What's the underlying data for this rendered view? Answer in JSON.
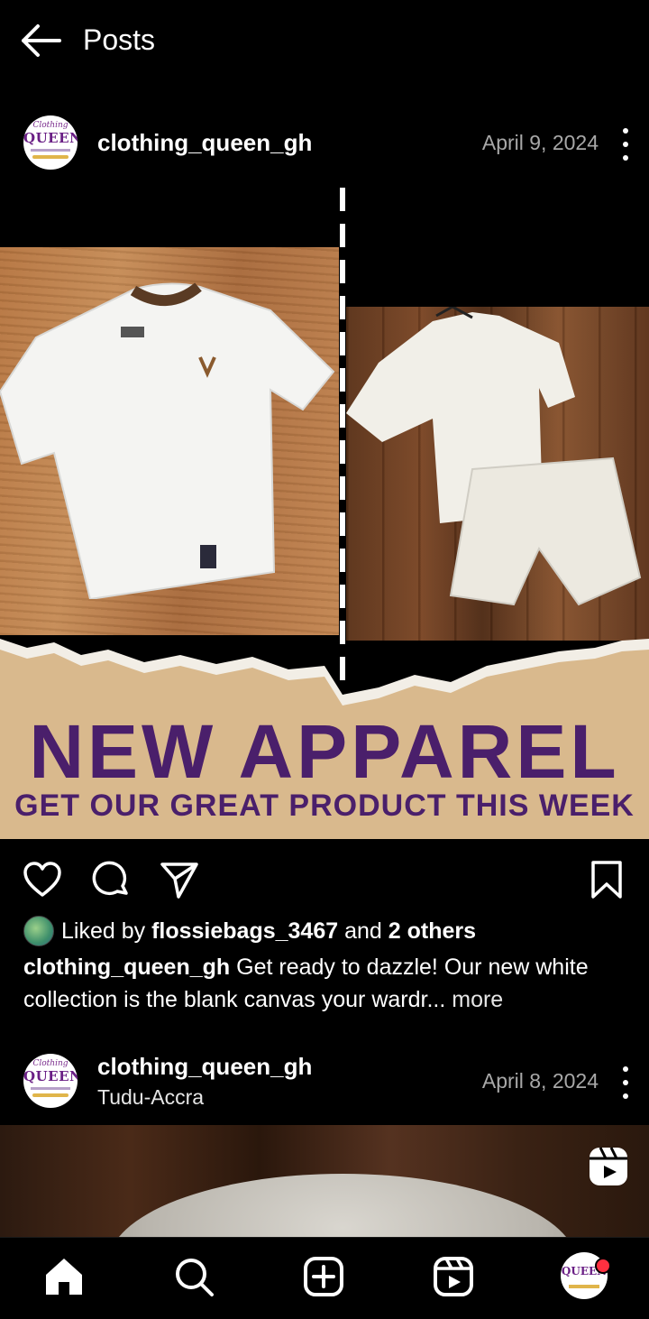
{
  "header": {
    "title": "Posts",
    "back_icon": "arrow-left-icon"
  },
  "posts": [
    {
      "username": "clothing_queen_gh",
      "location": "",
      "date": "April 9, 2024",
      "avatar_logo_top": "Clothing",
      "avatar_logo_main": "QUEEN",
      "image": {
        "banner_title": "NEW APPAREL",
        "banner_subtitle": "GET OUR GREAT PRODUCT THIS WEEK"
      },
      "likes": {
        "prefix": "Liked by",
        "user": "flossiebags_3467",
        "and": "and",
        "others": "2 others"
      },
      "caption": {
        "username": "clothing_queen_gh",
        "text": "Get ready to dazzle! Our new white collection is the blank canvas your wardr...",
        "more": "more"
      }
    },
    {
      "username": "clothing_queen_gh",
      "location": "Tudu-Accra",
      "date": "April 8, 2024",
      "avatar_logo_top": "Clothing",
      "avatar_logo_main": "QUEEN"
    }
  ],
  "colors": {
    "background": "#000000",
    "banner_text": "#4a1f6b",
    "banner_paper": "#d9b98d",
    "notification": "#ff3040",
    "muted_text": "#a8a8a8"
  },
  "nav": {
    "items": [
      "home-icon",
      "search-icon",
      "create-icon",
      "reels-icon",
      "profile-avatar"
    ]
  }
}
